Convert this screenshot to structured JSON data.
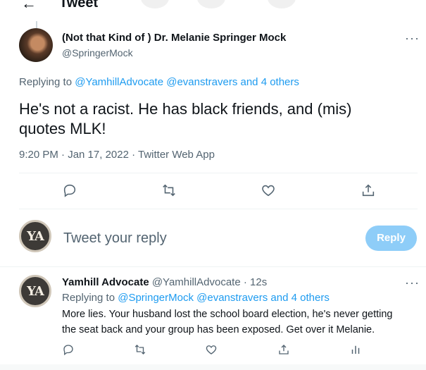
{
  "header": {
    "back_icon": "arrow-left-icon",
    "title": "Tweet"
  },
  "tweet": {
    "author_name": "(Not that Kind of ) Dr. Melanie Springer Mock",
    "author_handle": "@SpringerMock",
    "replying_prefix": "Replying to ",
    "replying_mentions": "@YamhillAdvocate @evanstravers",
    "replying_others": "and 4 others",
    "text_line1": "He's not a racist. He has black friends, and (mis)",
    "text_line2": "quotes MLK!",
    "meta": "9:20 PM · Jan 17, 2022 · Twitter Web App",
    "more_label": "···"
  },
  "compose": {
    "avatar_text": "YA",
    "placeholder": "Tweet your reply",
    "reply_button": "Reply"
  },
  "reply": {
    "author_name": "Yamhill Advocate",
    "author_handle": "@YamhillAdvocate",
    "time": "· 12s",
    "avatar_text": "YA",
    "replying_prefix": "Replying to ",
    "replying_mentions": "@SpringerMock @evanstravers",
    "replying_others": "and 4 others",
    "text_line1": "More lies. Your husband lost the school board election, he's never getting",
    "text_line2": "the seat back and your group has been exposed. Get over it Melanie.",
    "more_label": "···"
  },
  "icons": [
    "reply-icon",
    "retweet-icon",
    "like-icon",
    "share-icon",
    "analytics-icon"
  ],
  "colors": {
    "link": "#1d9bf0",
    "secondary_text": "#536471",
    "reply_button_bg": "#8ecdf8"
  }
}
